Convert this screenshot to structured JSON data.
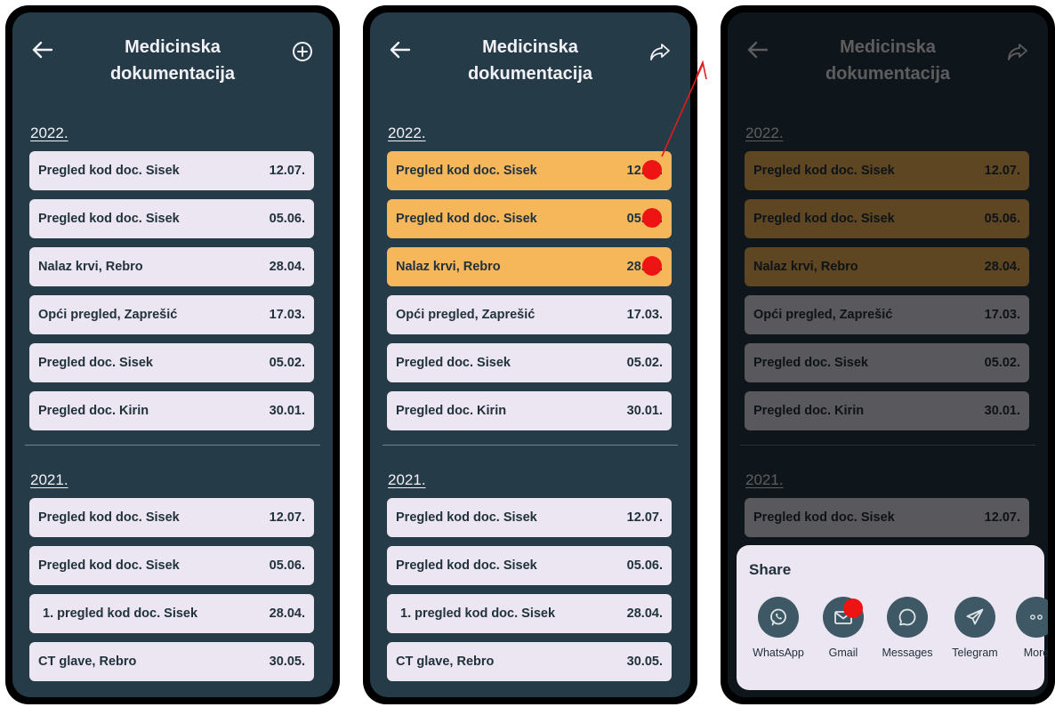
{
  "title_line1": "Medicinska",
  "title_line2": "dokumentacija",
  "year_2022": "2022.",
  "year_2021": "2021.",
  "records_2022": [
    {
      "label": "Pregled kod doc. Sisek",
      "date": "12.07."
    },
    {
      "label": "Pregled kod doc. Sisek",
      "date": "05.06."
    },
    {
      "label": "Nalaz krvi, Rebro",
      "date": "28.04."
    },
    {
      "label": "Opći pregled, Zaprešić",
      "date": "17.03."
    },
    {
      "label": "Pregled doc. Sisek",
      "date": "05.02."
    },
    {
      "label": "Pregled doc. Kirin",
      "date": "30.01."
    }
  ],
  "records_2021": [
    {
      "label": "Pregled kod doc. Sisek",
      "date": "12.07."
    },
    {
      "label": "Pregled kod doc. Sisek",
      "date": "05.06."
    },
    {
      "label": "1. pregled kod doc. Sisek",
      "date": "28.04."
    },
    {
      "label": "CT glave, Rebro",
      "date": "30.05."
    }
  ],
  "share": {
    "title": "Share",
    "apps": [
      "WhatsApp",
      "Gmail",
      "Messages",
      "Telegram",
      "More"
    ]
  },
  "colors": {
    "screen_bg": "#253c48",
    "card_bg": "#ebe6f1",
    "selected_card": "#f6b75b",
    "tap_marker": "#ee1414",
    "share_icon_bg": "#3f5865"
  },
  "icons": {
    "back": "arrow-left-icon",
    "add": "plus-circle-icon",
    "share": "share-arrow-icon"
  }
}
